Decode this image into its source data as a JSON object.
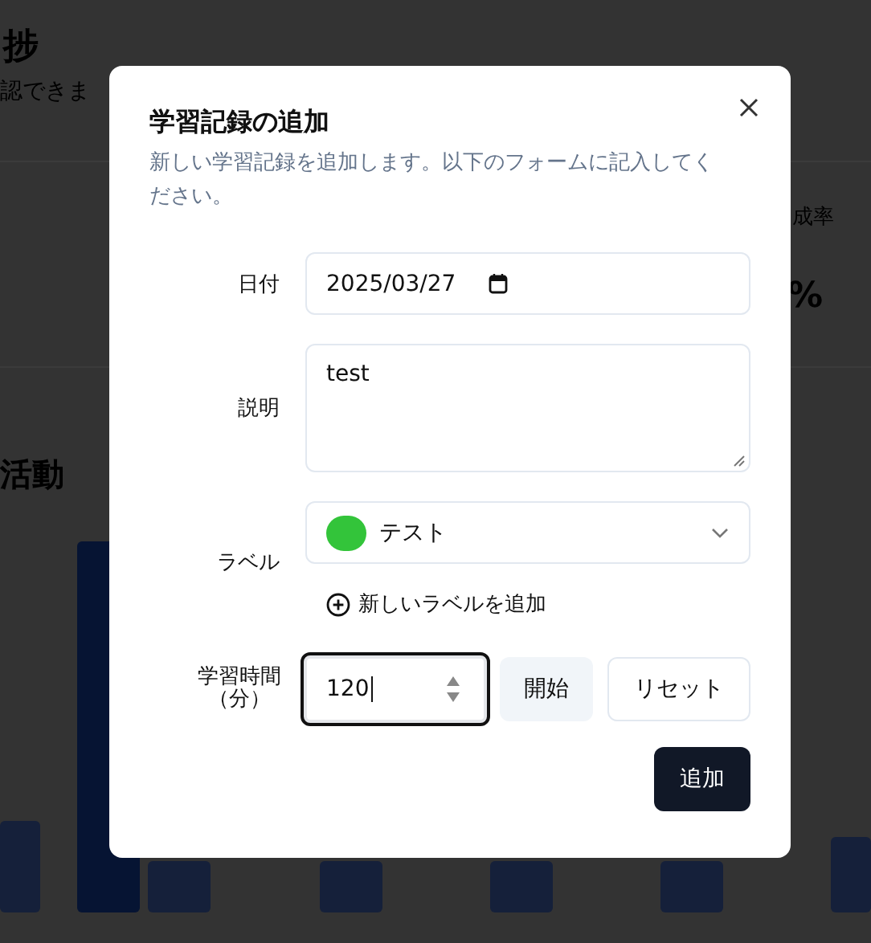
{
  "background": {
    "heading": "捗",
    "subtitle": "認できま",
    "stat_label": "成率",
    "stat_value": "%",
    "section_title": "活動"
  },
  "dialog": {
    "title": "学習記録の追加",
    "description": "新しい学習記録を追加します。以下のフォームに記入してください。",
    "fields": [
      {
        "kind": "date",
        "label": "日付",
        "value": "2025/03/27"
      },
      {
        "kind": "textarea",
        "label": "説明",
        "value": "test"
      },
      {
        "kind": "select",
        "label": "ラベル",
        "value": "テスト",
        "color": "#33c43a",
        "link": "新しいラベルを追加"
      },
      {
        "kind": "number",
        "label": "学習時間（分）",
        "value": "120",
        "focused": true,
        "buttons": [
          "開始",
          "リセット"
        ]
      }
    ],
    "submit": "追加"
  }
}
